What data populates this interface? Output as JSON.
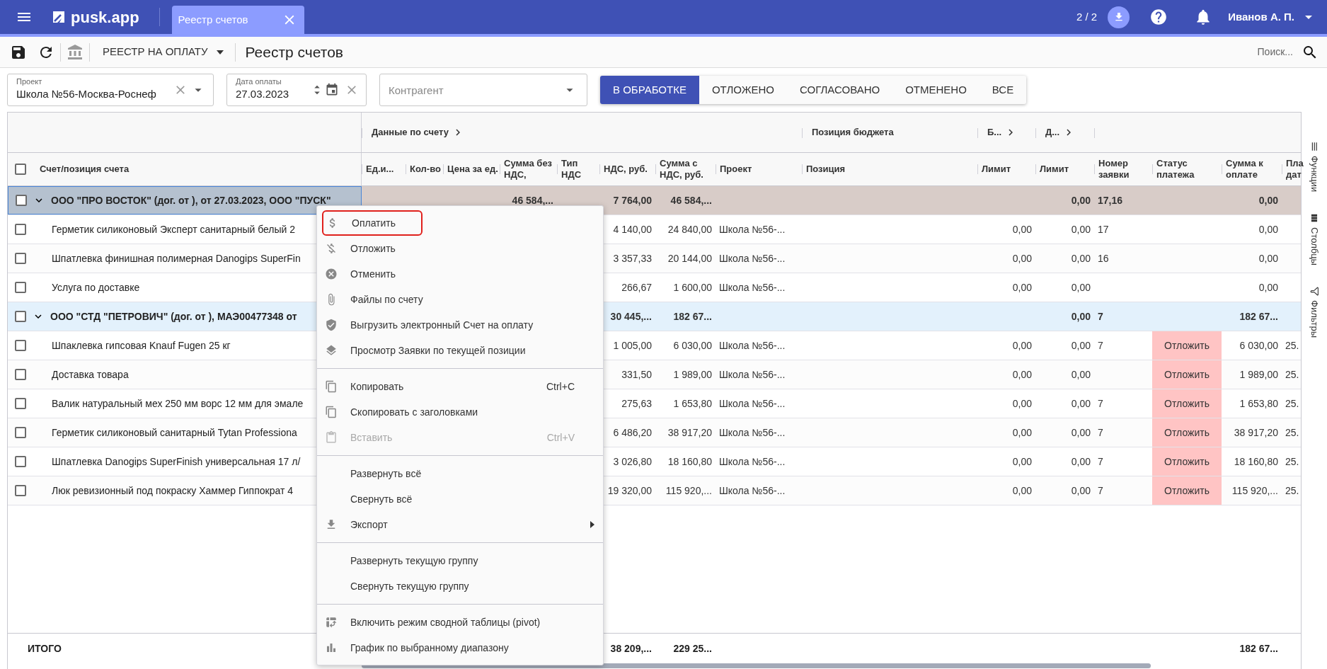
{
  "header": {
    "app_name": "pusk.app",
    "tab": {
      "label": "Реестр счетов",
      "selected": true
    },
    "counter": "2 / 2",
    "user": "Иванов А. П."
  },
  "toolbar": {
    "register_select": "РЕЕСТР НА ОПЛАТУ",
    "title": "Реестр счетов",
    "search": {
      "placeholder": "Поиск..."
    }
  },
  "filters": {
    "project": {
      "label": "Проект",
      "value": "Школа №56-Москва-Роснеф"
    },
    "payment_date": {
      "label": "Дата оплаты",
      "value": "27.03.2023"
    },
    "counterparty": {
      "placeholder": "Контрагент"
    }
  },
  "status_tabs": [
    {
      "label": "В ОБРАБОТКЕ",
      "selected": true
    },
    {
      "label": "ОТЛОЖЕНО",
      "selected": false
    },
    {
      "label": "СОГЛАСОВАНО",
      "selected": false
    },
    {
      "label": "ОТМЕНЕНО",
      "selected": false
    },
    {
      "label": "ВСЕ",
      "selected": false
    }
  ],
  "table": {
    "column_groups": [
      {
        "label": "Данные по счету",
        "expandable": true
      },
      {
        "label": "Позиция бюджета",
        "expandable": false
      },
      {
        "label": "Б...",
        "expandable": true
      },
      {
        "label": "Д...",
        "expandable": true
      }
    ],
    "header_checked": false,
    "columns": [
      "Счет/позиция счета",
      "Ед.и...",
      "Кол-во",
      "Цена за ед.",
      "Сумма без НДС,",
      "Тип НДС",
      "НДС, руб.",
      "Сумма с НДС, руб.",
      "Проект",
      "Позиция",
      "Лимит",
      "Лимит",
      "Номер заявки",
      "Статус платежа",
      "Сумма к оплате",
      "Пла дат"
    ],
    "rows": [
      {
        "kind": "group",
        "checked": false,
        "expanded": true,
        "selected": true,
        "name": "ООО \"ПРО ВОСТОК\" (дог. от ), от 27.03.2023, ООО \"ПУСК\"",
        "sum_no_nds": "46 584,...",
        "nds": "7 764,00",
        "sum_with_nds": "46 584,...",
        "limit_2": "0,00",
        "request_no": "17,16",
        "sum_to_pay": "0,00"
      },
      {
        "kind": "item",
        "checked": false,
        "name": "Герметик силиконовый Эксперт санитарный белый 2",
        "nds": "4 140,00",
        "sum_with_nds": "24 840,00",
        "project": "Школа №56-...",
        "limit_1": "0,00",
        "limit_2": "0,00",
        "request_no": "17",
        "sum_to_pay": "0,00"
      },
      {
        "kind": "item",
        "checked": false,
        "name": "Шпатлевка финишная полимерная Danogips SuperFin",
        "nds": "3 357,33",
        "sum_with_nds": "20 144,00",
        "project": "Школа №56-...",
        "limit_1": "0,00",
        "limit_2": "0,00",
        "request_no": "16",
        "sum_to_pay": "0,00"
      },
      {
        "kind": "item",
        "checked": false,
        "name": "Услуга по доставке",
        "nds": "266,67",
        "sum_with_nds": "1 600,00",
        "project": "Школа №56-...",
        "limit_1": "0,00",
        "limit_2": "0,00",
        "sum_to_pay": "0,00"
      },
      {
        "kind": "group",
        "checked": false,
        "expanded": true,
        "selected": false,
        "name": "ООО \"СТД \"ПЕТРОВИЧ\" (дог. от ), МАЭ00477348 от",
        "nds": "30 445,...",
        "sum_with_nds": "182 67...",
        "limit_2": "0,00",
        "request_no": "7",
        "sum_to_pay": "182 67..."
      },
      {
        "kind": "item",
        "checked": false,
        "name": "Шпаклевка гипсовая Knauf Fugen 25 кг",
        "nds": "1 005,00",
        "sum_with_nds": "6 030,00",
        "project": "Школа №56-...",
        "limit_1": "0,00",
        "limit_2": "0,00",
        "request_no": "7",
        "payment_status": "Отложить",
        "sum_to_pay": "6 030,00",
        "column_16": "25."
      },
      {
        "kind": "item",
        "checked": false,
        "name": "Доставка товара",
        "nds": "331,50",
        "sum_with_nds": "1 989,00",
        "project": "Школа №56-...",
        "limit_1": "0,00",
        "limit_2": "0,00",
        "payment_status": "Отложить",
        "sum_to_pay": "1 989,00",
        "column_16": "25."
      },
      {
        "kind": "item",
        "checked": false,
        "name": "Валик натуральный мех 250 мм ворс 12 мм для эмале",
        "nds": "275,63",
        "sum_with_nds": "1 653,80",
        "project": "Школа №56-...",
        "limit_1": "0,00",
        "limit_2": "0,00",
        "request_no": "7",
        "payment_status": "Отложить",
        "sum_to_pay": "1 653,80",
        "column_16": "25."
      },
      {
        "kind": "item",
        "checked": false,
        "name": "Герметик силиконовый санитарный Tytan Professiona",
        "nds": "6 486,20",
        "sum_with_nds": "38 917,20",
        "project": "Школа №56-...",
        "limit_1": "0,00",
        "limit_2": "0,00",
        "request_no": "7",
        "payment_status": "Отложить",
        "sum_to_pay": "38 917,20",
        "column_16": "25."
      },
      {
        "kind": "item",
        "checked": false,
        "name": "Шпатлевка Danogips SuperFinish универсальная 17 л/",
        "nds": "3 026,80",
        "sum_with_nds": "18 160,80",
        "project": "Школа №56-...",
        "limit_1": "0,00",
        "limit_2": "0,00",
        "request_no": "7",
        "payment_status": "Отложить",
        "sum_to_pay": "18 160,80",
        "column_16": "25."
      },
      {
        "kind": "item",
        "checked": false,
        "name": "Люк ревизионный под покраску Хаммер Гиппократ 4",
        "nds": "19 320,00",
        "sum_with_nds": "115 920,...",
        "project": "Школа №56-...",
        "limit_1": "0,00",
        "limit_2": "0,00",
        "request_no": "7",
        "payment_status": "Отложить",
        "sum_to_pay": "115 920,...",
        "column_16": "25."
      }
    ],
    "totals": {
      "name": "ИТОГО",
      "nds": "38 209,...",
      "sum_with_nds": "229 25...",
      "sum_to_pay": "182 67..."
    }
  },
  "side_panel": [
    {
      "label": "Функции"
    },
    {
      "label": "Столбцы"
    },
    {
      "label": "Фильтры"
    }
  ],
  "context_menu": {
    "sections": [
      {
        "items": [
          {
            "label": "Оплатить",
            "selected": true,
            "disabled": false
          },
          {
            "label": "Отложить",
            "selected": false,
            "disabled": false
          },
          {
            "label": "Отменить",
            "selected": false,
            "disabled": false
          },
          {
            "label": "Файлы по счету",
            "selected": false,
            "disabled": false
          },
          {
            "label": "Выгрузить электронный Счет на оплату",
            "selected": false,
            "disabled": false
          },
          {
            "label": "Просмотр Заявки по текущей позиции",
            "selected": false,
            "disabled": false
          }
        ]
      },
      {
        "items": [
          {
            "label": "Копировать",
            "shortcut": "Ctrl+C",
            "selected": false,
            "disabled": false
          },
          {
            "label": "Скопировать с заголовками",
            "selected": false,
            "disabled": false
          },
          {
            "label": "Вставить",
            "shortcut": "Ctrl+V",
            "selected": false,
            "disabled": true
          }
        ]
      },
      {
        "items": [
          {
            "label": "Развернуть всё",
            "selected": false,
            "disabled": false
          },
          {
            "label": "Свернуть всё",
            "selected": false,
            "disabled": false
          },
          {
            "label": "Экспорт",
            "submenu": true,
            "selected": false,
            "disabled": false
          }
        ]
      },
      {
        "items": [
          {
            "label": "Развернуть текущую группу",
            "selected": false,
            "disabled": false
          },
          {
            "label": "Свернуть текущую группу",
            "selected": false,
            "disabled": false
          }
        ]
      },
      {
        "items": [
          {
            "label": "Включить режим сводной таблицы (pivot)",
            "selected": false,
            "disabled": false
          },
          {
            "label": "График по выбранному диапазону",
            "selected": false,
            "disabled": false
          }
        ]
      }
    ]
  }
}
